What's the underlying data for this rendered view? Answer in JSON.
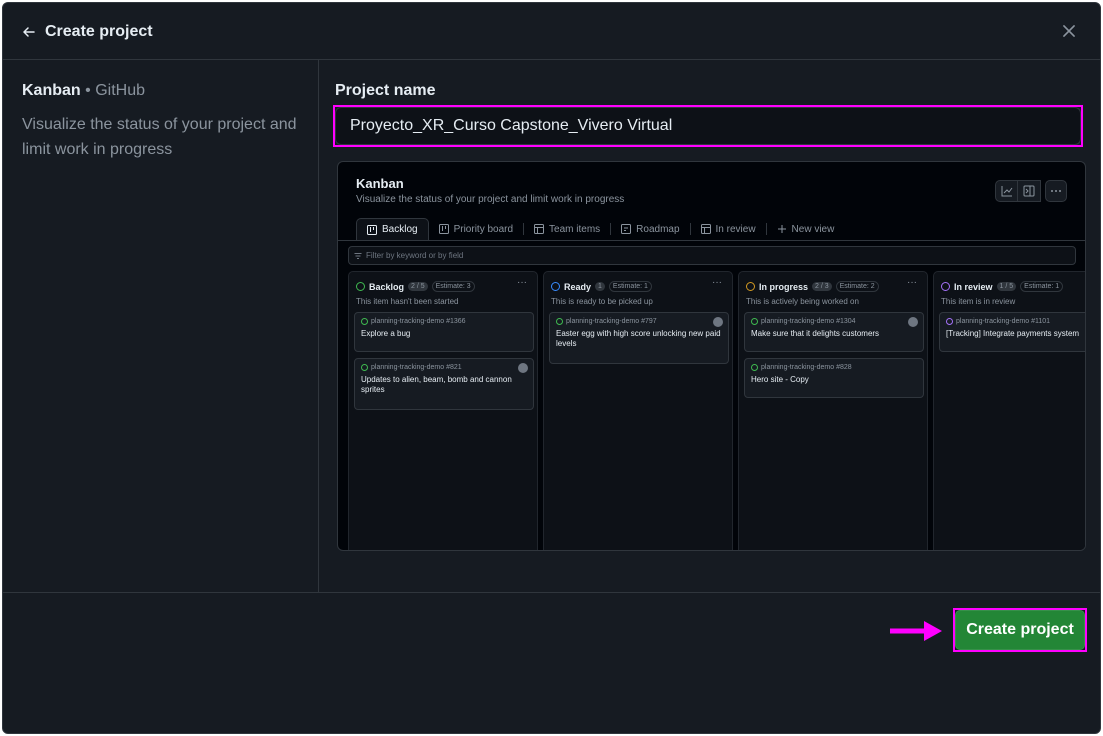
{
  "header": {
    "title": "Create project",
    "back_icon": "arrow-left-icon",
    "close_icon": "close-icon"
  },
  "sidebar": {
    "template_name": "Kanban",
    "separator": "•",
    "template_author": "GitHub",
    "description": "Visualize the status of your project and limit work in progress"
  },
  "form": {
    "project_name_label": "Project name",
    "project_name_value": "Proyecto_XR_Curso Capstone_Vivero Virtual"
  },
  "preview": {
    "title": "Kanban",
    "description": "Visualize the status of your project and limit work in progress",
    "tabs": [
      {
        "label": "Backlog",
        "icon": "board-icon"
      },
      {
        "label": "Priority board",
        "icon": "board-icon"
      },
      {
        "label": "Team items",
        "icon": "table-icon"
      },
      {
        "label": "Roadmap",
        "icon": "calendar-icon"
      },
      {
        "label": "In review",
        "icon": "table-icon"
      },
      {
        "label": "New view",
        "icon": "plus-icon"
      }
    ],
    "filter_placeholder": "Filter by keyword or by field",
    "columns": [
      {
        "name": "Backlog",
        "color": "#3fb950",
        "count": "2 / 5",
        "estimate": "Estimate: 3",
        "description": "This item hasn't been started",
        "cards": [
          {
            "ref": "planning-tracking-demo #1366",
            "title": "Explore a bug"
          },
          {
            "ref": "planning-tracking-demo #821",
            "title": "Updates to alien, beam, bomb and cannon sprites"
          }
        ]
      },
      {
        "name": "Ready",
        "color": "#388bfd",
        "count": "1",
        "estimate": "Estimate: 1",
        "description": "This is ready to be picked up",
        "cards": [
          {
            "ref": "planning-tracking-demo #797",
            "title": "Easter egg with high score unlocking new paid levels"
          }
        ]
      },
      {
        "name": "In progress",
        "color": "#d29922",
        "count": "2 / 3",
        "estimate": "Estimate: 2",
        "description": "This is actively being worked on",
        "cards": [
          {
            "ref": "planning-tracking-demo #1304",
            "title": "Make sure that it delights customers"
          },
          {
            "ref": "planning-tracking-demo #828",
            "title": "Hero site - Copy"
          }
        ]
      },
      {
        "name": "In review",
        "color": "#a371f7",
        "count": "1 / 5",
        "estimate": "Estimate: 1",
        "description": "This item is in review",
        "cards": [
          {
            "ref": "planning-tracking-demo #1101",
            "title": "[Tracking] Integrate payments system"
          }
        ]
      }
    ]
  },
  "footer": {
    "create_label": "Create project",
    "accent": "#238636",
    "highlight": "#ff00ff"
  }
}
